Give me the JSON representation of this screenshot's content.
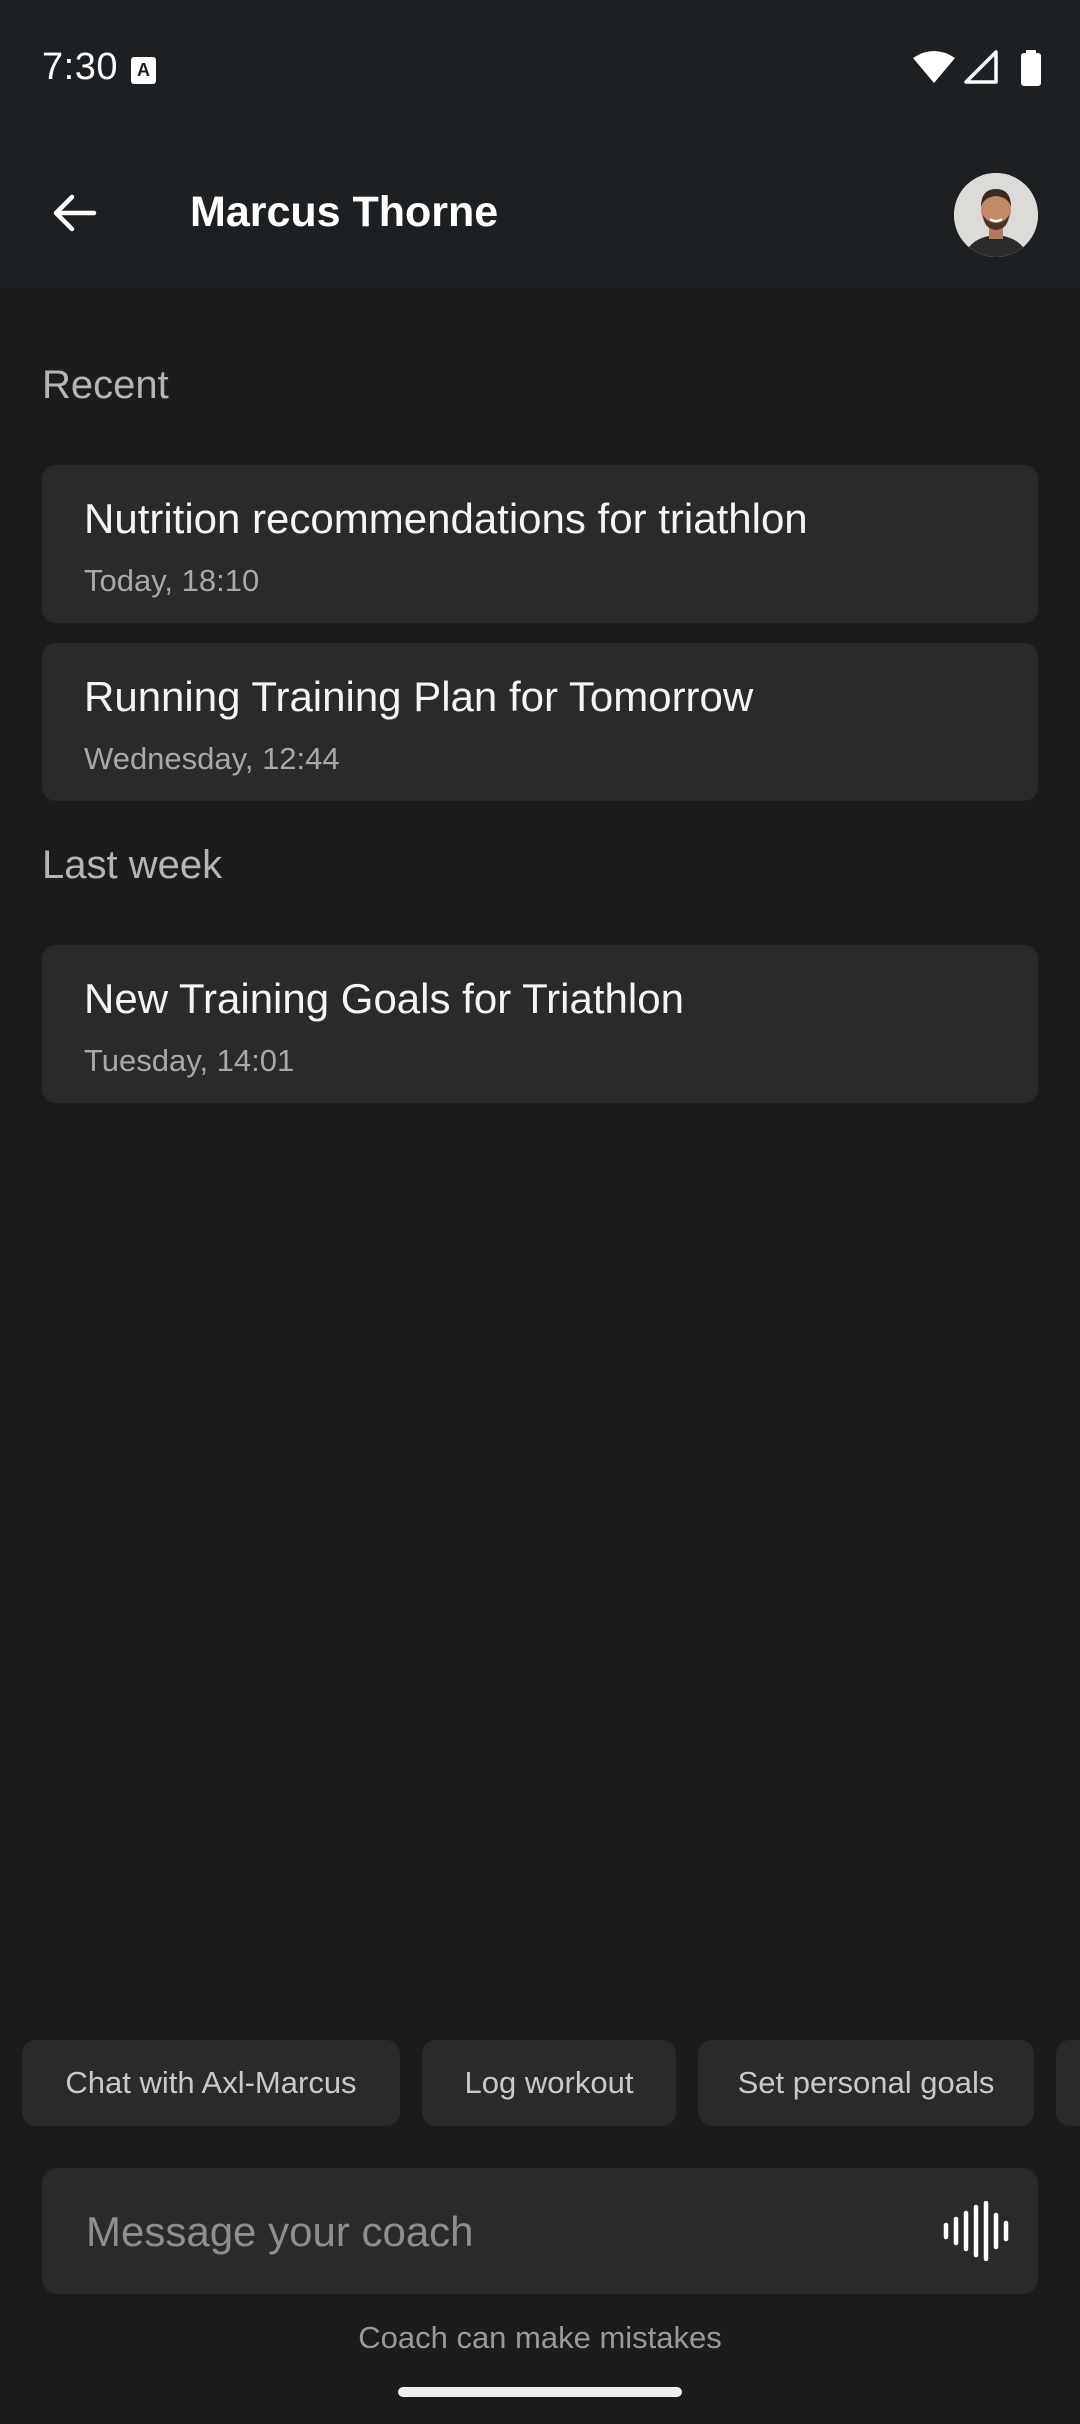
{
  "status_bar": {
    "time": "7:30",
    "notification_icon": "a-icon",
    "icons": [
      "wifi-icon",
      "cellular-signal-icon",
      "battery-icon"
    ]
  },
  "header": {
    "title": "Marcus Thorne",
    "back_icon": "arrow-left-icon",
    "avatar": "coach-avatar"
  },
  "sections": [
    {
      "label": "Recent",
      "items": [
        {
          "title": "Nutrition recommendations for triathlon",
          "time": "Today, 18:10"
        },
        {
          "title": "Running Training Plan for Tomorrow",
          "time": "Wednesday, 12:44"
        }
      ]
    },
    {
      "label": "Last week",
      "items": [
        {
          "title": "New Training Goals for Triathlon",
          "time": "Tuesday, 14:01"
        }
      ]
    }
  ],
  "suggestions": [
    "Chat with Axl-Marcus",
    "Log workout",
    "Set personal goals"
  ],
  "composer": {
    "placeholder": "Message your coach",
    "voice_icon": "voice-waveform-icon"
  },
  "disclaimer": "Coach can make mistakes",
  "colors": {
    "background": "#1c1c1c",
    "header_background": "#1d2022",
    "card_background": "#2a2a2a",
    "text_primary": "#f2f2f2",
    "text_secondary": "#a8a8a8"
  }
}
